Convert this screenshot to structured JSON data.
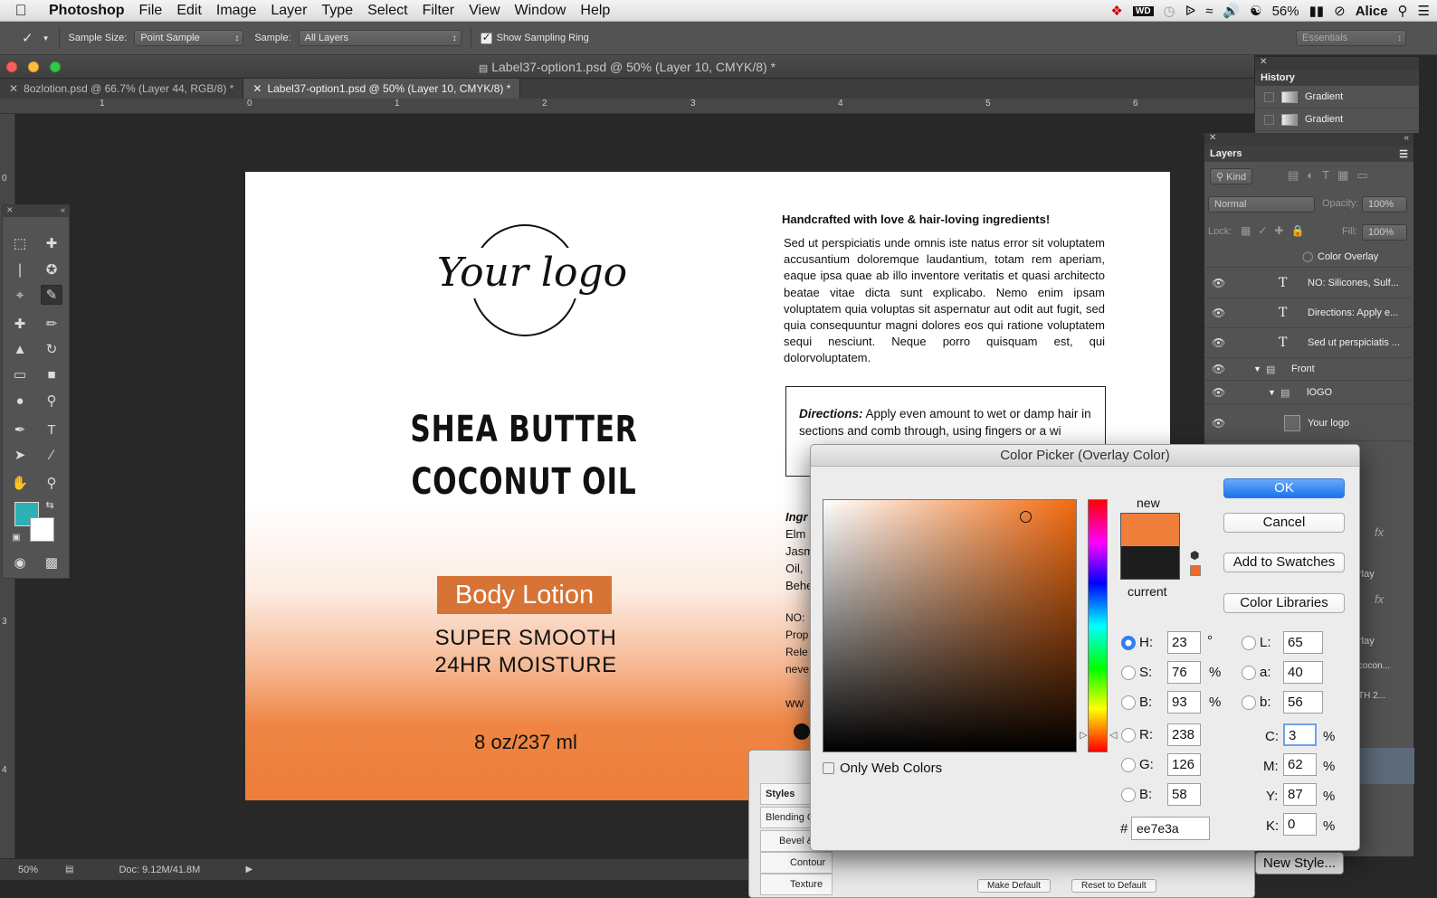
{
  "menubar": {
    "app": "Photoshop",
    "items": [
      "File",
      "Edit",
      "Image",
      "Layer",
      "Type",
      "Select",
      "Filter",
      "View",
      "Window",
      "Help"
    ],
    "battery": "56%",
    "user": "Alice"
  },
  "options": {
    "sample_size_label": "Sample Size:",
    "sample_size_value": "Point Sample",
    "sample_label": "Sample:",
    "sample_value": "All Layers",
    "show_ring_label": "Show Sampling Ring",
    "workspace": "Essentials"
  },
  "window": {
    "title": "Label37-option1.psd @ 50% (Layer 10, CMYK/8) *",
    "tabs": [
      "8ozlotion.psd @ 66.7% (Layer 44, RGB/8) *",
      "Label37-option1.psd @ 50% (Layer 10, CMYK/8) *"
    ]
  },
  "rulers": {
    "h": [
      "1",
      "0",
      "1",
      "2",
      "3",
      "4",
      "5",
      "6"
    ],
    "v": [
      "0",
      "3",
      "4"
    ]
  },
  "document": {
    "logo": "Your logo",
    "title_line1": "SHEA BUTTER",
    "title_line2": "COCONUT OIL",
    "badge": "Body Lotion",
    "sub_line1": "SUPER SMOOTH",
    "sub_line2": "24HR MOISTURE",
    "size": "8 oz/237 ml",
    "right_heading": "Handcrafted with love & hair-loving ingredients!",
    "right_body": "Sed ut perspiciatis unde omnis iste natus error sit voluptatem accusantium doloremque laudantium, totam rem aperiam, eaque ipsa quae ab illo inventore veritatis et quasi architecto beatae vitae dicta sunt explicabo. Nemo enim ipsam voluptatem quia voluptas sit aspernatur aut odit aut fugit, sed quia consequuntur magni dolores eos qui ratione voluptatem sequi nesciunt. Neque porro quisquam est, qui dolorvoluptatem.",
    "directions_label": "Directions:",
    "directions_text": "Apply even amount to wet or damp hair in sections and comb through, using fingers or a wi",
    "partial_lines": [
      "Ingr",
      "Elm",
      "Jasm",
      "Oil,",
      "Behe"
    ],
    "partial_lines2": [
      "NO:",
      "Prop",
      "Rele",
      "neve"
    ],
    "partial_www": "ww"
  },
  "status": {
    "zoom": "50%",
    "doc": "Doc: 9.12M/41.8M"
  },
  "history": {
    "tab": "History",
    "items": [
      "Gradient",
      "Gradient"
    ]
  },
  "layers": {
    "tab": "Layers",
    "filter": "Kind",
    "blend": "Normal",
    "opacity_label": "Opacity:",
    "opacity": "100%",
    "lock_label": "Lock:",
    "fill_label": "Fill:",
    "fill": "100%",
    "rows": [
      "Color Overlay",
      "NO: Silicones, Sulf...",
      "Directions: Apply e...",
      "Sed ut perspiciatis ...",
      "Front",
      "lOGO",
      "Your logo"
    ],
    "partial_rows": [
      "rlay",
      "rlay",
      "cocon...",
      "TH 2..."
    ],
    "new_style": "New Style..."
  },
  "picker": {
    "title": "Color Picker (Overlay Color)",
    "new_label": "new",
    "current_label": "current",
    "ok": "OK",
    "cancel": "Cancel",
    "add_swatches": "Add to Swatches",
    "libraries": "Color Libraries",
    "only_web": "Only Web Colors",
    "H": "23",
    "S": "76",
    "Bv": "93",
    "R": "238",
    "G": "126",
    "Bb": "58",
    "L": "65",
    "a": "40",
    "b": "56",
    "C": "3",
    "M": "62",
    "Y": "87",
    "K": "0",
    "hex": "ee7e3a",
    "deg": "°",
    "pct": "%"
  },
  "layer_style": {
    "items": [
      "Styles",
      "Blending O",
      "Bevel &",
      "Contour",
      "Texture"
    ],
    "buttons": [
      "Make Default",
      "Reset to Default"
    ]
  },
  "colors": {
    "accent": "#ee7e3a",
    "foreground": "#2eb0b4",
    "badge": "#d67335"
  }
}
